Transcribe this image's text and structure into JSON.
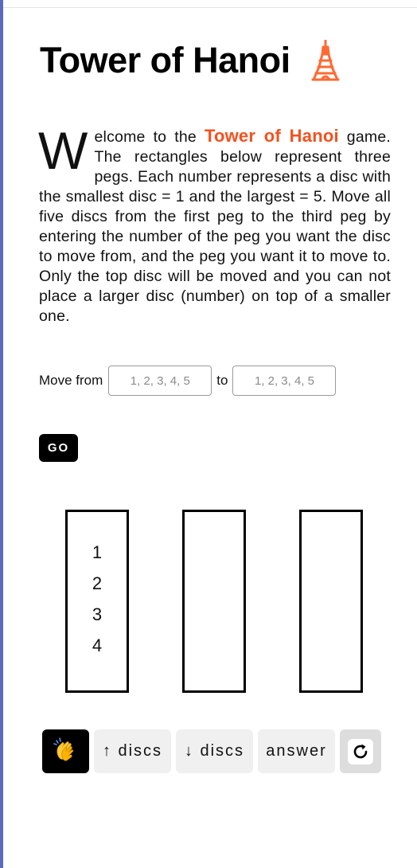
{
  "header": {
    "title": "Tower of Hanoi",
    "title_icon": "tokyo-tower-icon"
  },
  "intro": {
    "drop_cap": "W",
    "text_before": "elcome to the ",
    "game_name": "Tower of Hanoi",
    "text_after": " game. The rectangles below represent three pegs. Each number represents a disc with the smallest disc = 1 and the largest = 5. Move all five discs from the first peg to the third peg by entering the number of the peg you want the disc to move from, and the peg you want it to move to. Only the top disc will be moved and you can not place a larger disc (number) on top of a smaller one."
  },
  "move_form": {
    "from_label": "Move from",
    "from_value": "",
    "from_placeholder": "1, 2, 3, 4, 5",
    "to_label": "to",
    "to_value": "",
    "to_placeholder": "1, 2, 3, 4, 5",
    "go_label": "GO"
  },
  "pegs": [
    {
      "discs": [
        "1",
        "2",
        "3",
        "4"
      ]
    },
    {
      "discs": []
    },
    {
      "discs": []
    }
  ],
  "controls": {
    "clap_icon": "clapping-hands-icon",
    "more_discs_label": "↑ discs",
    "fewer_discs_label": "↓ discs",
    "answer_label": "answer",
    "reset_icon": "reset-icon"
  },
  "colors": {
    "accent": "#f4511e",
    "tower_icon": "#ff6a33",
    "left_rail": "#5b6abf",
    "button_dark": "#000000",
    "button_light": "#f0f0f0",
    "clap_yellow": "#ffc93c"
  }
}
